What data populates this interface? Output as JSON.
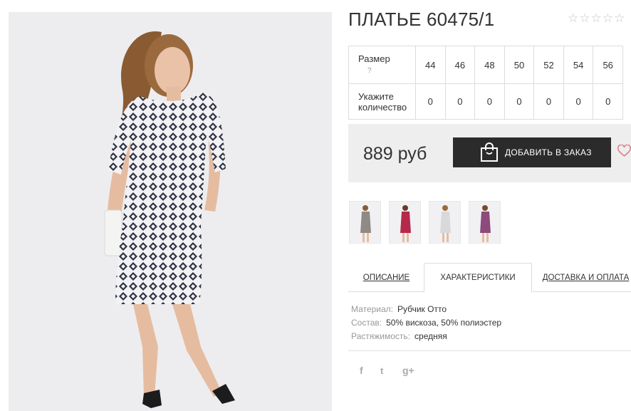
{
  "product": {
    "title": "ПЛАТЬЕ 60475/1",
    "rating": {
      "stars": 0,
      "max": 5
    }
  },
  "sizes_table": {
    "size_label": "Размер",
    "help_mark": "?",
    "quantity_label_1": "Укажите",
    "quantity_label_2": "количество",
    "sizes": [
      "44",
      "46",
      "48",
      "50",
      "52",
      "54",
      "56"
    ],
    "quantities": [
      "0",
      "0",
      "0",
      "0",
      "0",
      "0",
      "0"
    ]
  },
  "buybox": {
    "price": "889 руб",
    "add_button_label": "ДОБАВИТЬ В ЗАКАЗ"
  },
  "thumbnails": [
    {
      "color": "#8f8a86"
    },
    {
      "color": "#b52a4a"
    },
    {
      "color": "#d9d9db"
    },
    {
      "color": "#8d4a7a"
    }
  ],
  "tabs": [
    {
      "label": "ОПИСАНИЕ",
      "active": false
    },
    {
      "label": "ХАРАКТЕРИСТИКИ",
      "active": true
    },
    {
      "label": "ДОСТАВКА И ОПЛАТА",
      "active": false
    }
  ],
  "specs": [
    {
      "key": "Материал:",
      "value": "Рубчик Отто"
    },
    {
      "key": "Состав:",
      "value": "50% вискоза, 50% полиэстер"
    },
    {
      "key": "Растяжимость:",
      "value": "средняя"
    }
  ],
  "social": {
    "facebook": "f",
    "twitter": "t",
    "google": "g+"
  },
  "colors": {
    "button_bg": "#2b2b2b",
    "buybox_bg": "#eeeeee",
    "heart": "#e07a90"
  }
}
